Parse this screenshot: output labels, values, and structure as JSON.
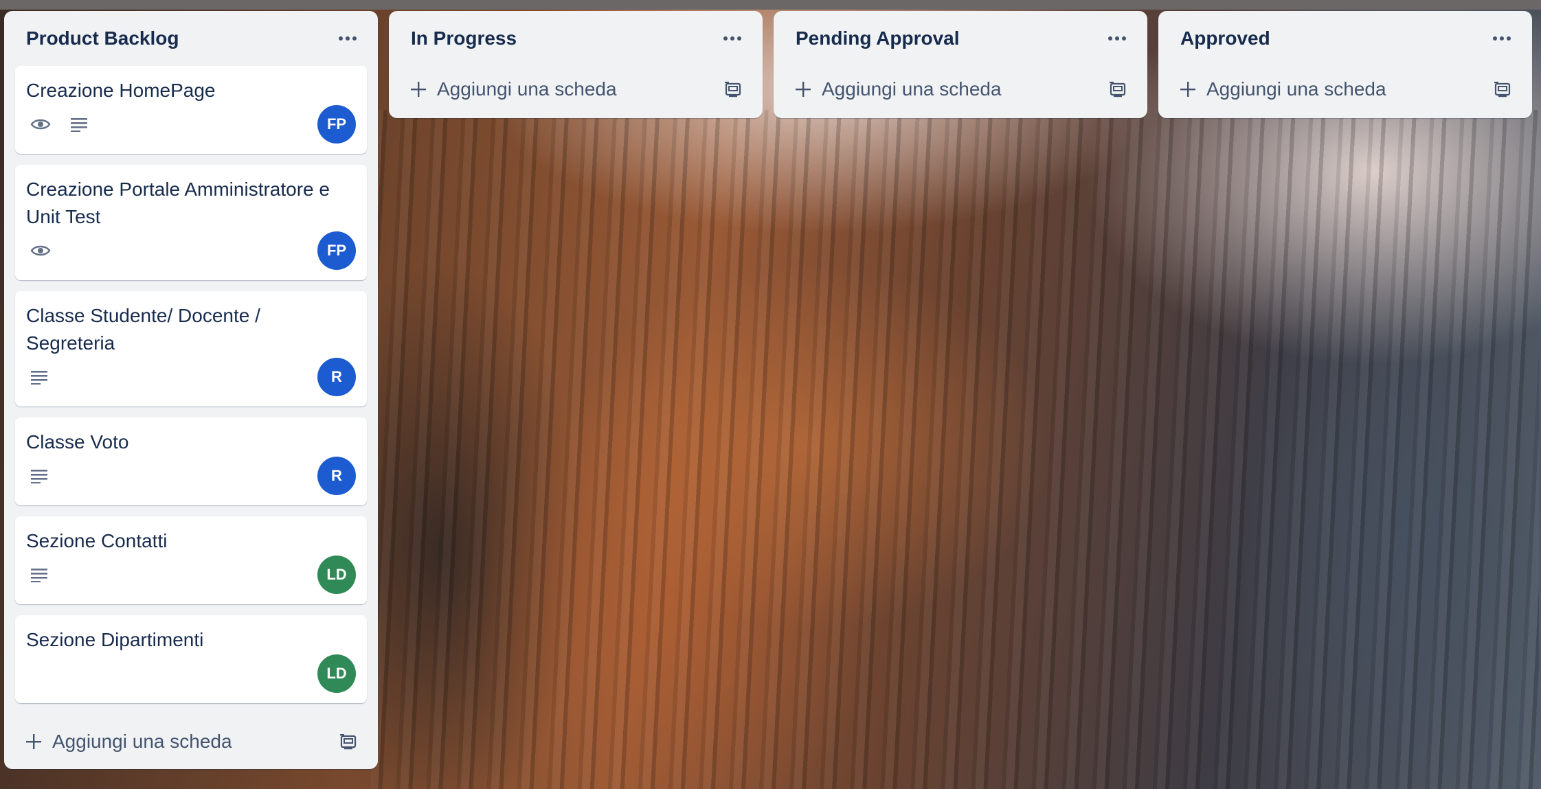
{
  "board": {
    "lists": [
      {
        "title": "Product Backlog",
        "cards": [
          {
            "title": "Creazione HomePage",
            "icons": [
              "eye-icon",
              "description-icon"
            ],
            "avatar": "FP",
            "avatar_color": "#1d5bd1"
          },
          {
            "title": "Creazione Portale Amministratore e Unit Test",
            "icons": [
              "eye-icon"
            ],
            "avatar": "FP",
            "avatar_color": "#1d5bd1"
          },
          {
            "title": "Classe Studente/ Docente / Segreteria",
            "icons": [
              "description-icon"
            ],
            "avatar": "R",
            "avatar_color": "#1d5bd1"
          },
          {
            "title": "Classe Voto",
            "icons": [
              "description-icon"
            ],
            "avatar": "R",
            "avatar_color": "#1d5bd1"
          },
          {
            "title": "Sezione Contatti",
            "icons": [
              "description-icon"
            ],
            "avatar": "LD",
            "avatar_color": "#2f8a57"
          },
          {
            "title": "Sezione Dipartimenti",
            "icons": [],
            "avatar": "LD",
            "avatar_color": "#2f8a57"
          }
        ],
        "add_label": "Aggiungi una scheda"
      },
      {
        "title": "In Progress",
        "cards": [],
        "add_label": "Aggiungi una scheda"
      },
      {
        "title": "Pending Approval",
        "cards": [],
        "add_label": "Aggiungi una scheda"
      },
      {
        "title": "Approved",
        "cards": [],
        "add_label": "Aggiungi una scheda"
      }
    ]
  },
  "colors": {
    "list_bg": "#f1f2f4",
    "text": "#172b4d",
    "subtle_text": "#44546f",
    "blue_avatar": "#1d5bd1",
    "green_avatar": "#2f8a57"
  }
}
